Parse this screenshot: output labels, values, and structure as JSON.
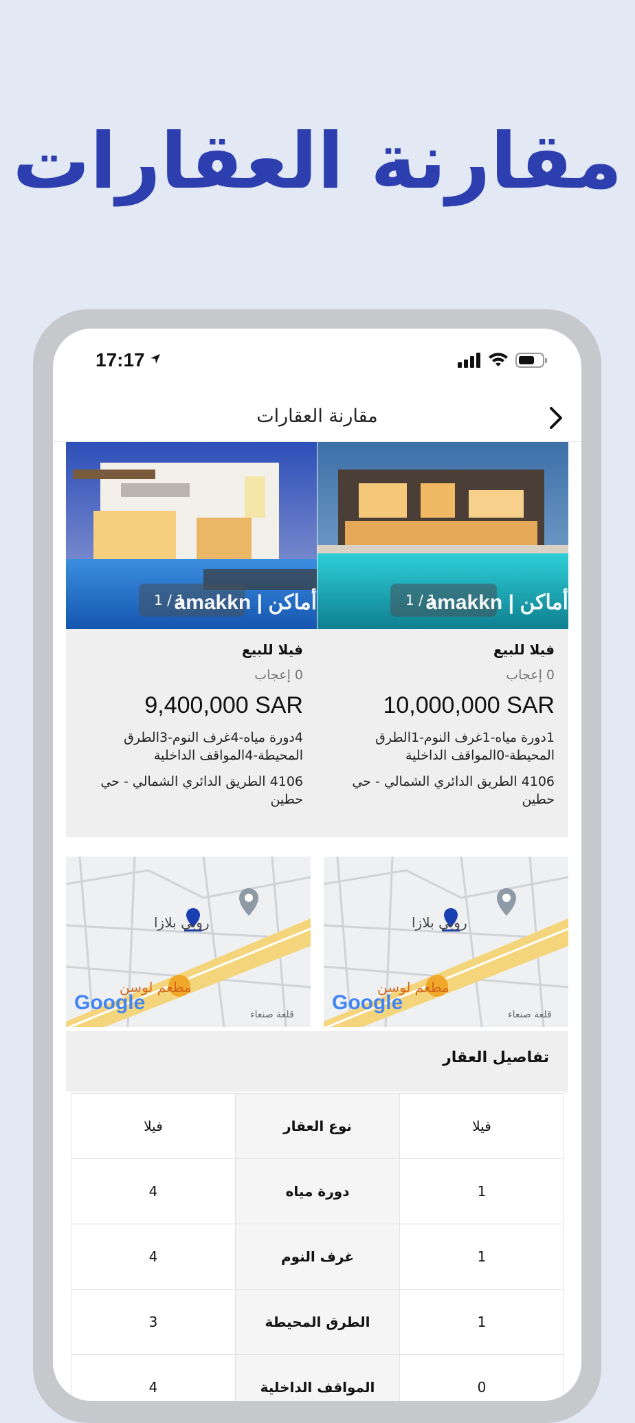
{
  "promo": {
    "headline": "مقارنة العقارات"
  },
  "status_bar": {
    "time": "17:17"
  },
  "nav": {
    "title": "مقارنة العقارات",
    "back_icon": "chevron-right-icon"
  },
  "cards": [
    {
      "type": "فيلا للبيع",
      "likes": "0 إعجاب",
      "price": "10,000,000 SAR",
      "features": "1دورة مياه-1غرف النوم-1الطرق المحيطة-0المواقف الداخلية",
      "address": "4106 الطريق الدائري الشمالي - حي حطين",
      "image_counter": "1 / 1",
      "watermark": "amakkn | أماكن"
    },
    {
      "type": "فيلا للبيع",
      "likes": "0 إعجاب",
      "price": "9,400,000 SAR",
      "features": "4دورة مياه-4غرف النوم-3الطرق المحيطة-4المواقف الداخلية",
      "address": "4106 الطريق الدائري الشمالي - حي حطين",
      "image_counter": "1 / 1",
      "watermark": "amakkn | أماكن"
    }
  ],
  "maps": [
    {
      "place": "روبي بلازا",
      "restaurant": "مطعم لوسن",
      "street": "قلعة صنعاء",
      "brand": "Google"
    },
    {
      "place": "روبي بلازا",
      "restaurant": "مطعم لوسن",
      "street": "قلعة صنعاء",
      "brand": "Google"
    }
  ],
  "details": {
    "title": "تفاصيل العقار",
    "rows": [
      {
        "right": "فيلا",
        "label": "نوع العقار",
        "left": "فيلا"
      },
      {
        "right": "1",
        "label": "دورة مياه",
        "left": "4"
      },
      {
        "right": "1",
        "label": "غرف النوم",
        "left": "4"
      },
      {
        "right": "1",
        "label": "الطرق المحيطة",
        "left": "3"
      },
      {
        "right": "0",
        "label": "المواقف الداخلية",
        "left": "4"
      }
    ]
  },
  "colors": {
    "brand_blue": "#2d3fae",
    "background": "#e2e8f4"
  }
}
